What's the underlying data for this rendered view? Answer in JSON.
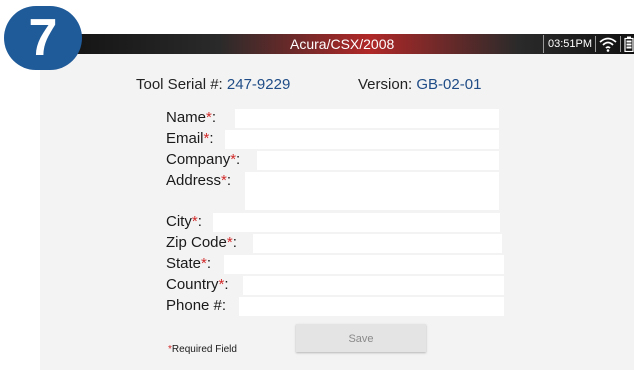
{
  "step": {
    "number": "7",
    "color": "#1f5a99"
  },
  "titlebar": {
    "title": "Acura/CSX/2008",
    "time": "03:51PM",
    "wifi_icon": "wifi-icon",
    "battery_icon": "battery-icon"
  },
  "tool": {
    "serial_label": "Tool Serial #: ",
    "serial_value": "247-9229",
    "version_label": "Version: ",
    "version_value": "GB-02-01"
  },
  "form": {
    "required_marker": "*",
    "fields": [
      {
        "label": "Name",
        "required": true,
        "value": ""
      },
      {
        "label": "Email",
        "required": true,
        "value": ""
      },
      {
        "label": "Company",
        "required": true,
        "value": ""
      },
      {
        "label": "Address",
        "required": true,
        "value": ""
      },
      {
        "label": "City",
        "required": true,
        "value": ""
      },
      {
        "label": "Zip Code",
        "required": true,
        "value": ""
      },
      {
        "label": "State",
        "required": true,
        "value": ""
      },
      {
        "label": "Country",
        "required": true,
        "value": ""
      },
      {
        "label": "Phone #",
        "required": false,
        "value": ""
      }
    ],
    "colon": ":",
    "required_note_marker": "*",
    "required_note_text": "Required Field",
    "save_label": "Save"
  },
  "colors": {
    "accent_blue": "#1f4c86",
    "required_red": "#d22a2a",
    "panel_bg": "#f3f3f3"
  }
}
